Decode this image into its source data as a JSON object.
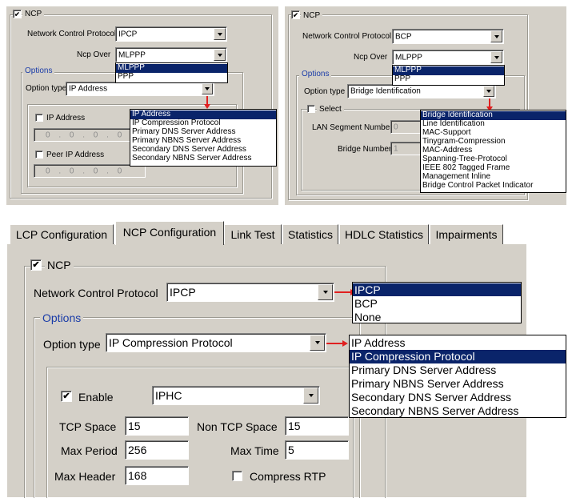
{
  "panel1": {
    "ncp_checkbox_label": "NCP",
    "protocol_label": "Network Control Protocol",
    "protocol_value": "IPCP",
    "ncp_over_label": "Ncp Over",
    "ncp_over_value": "MLPPP",
    "ncp_over_options": [
      "MLPPP",
      "PPP"
    ],
    "options_legend": "Options",
    "option_type_label": "Option type",
    "option_type_value": "IP Address",
    "option_type_options": [
      "IP Address",
      "IP Compression Protocol",
      "Primary DNS Server Address",
      "Primary NBNS Server Address",
      "Secondary DNS Server Address",
      "Secondary NBNS Server Address"
    ],
    "ip_address_label": "IP Address",
    "ip_address_value": "0 . 0 . 0 . 0",
    "peer_ip_label": "Peer IP Address",
    "peer_ip_value": "0 . 0 . 0 . 0"
  },
  "panel2": {
    "ncp_checkbox_label": "NCP",
    "protocol_label": "Network Control Protocol",
    "protocol_value": "BCP",
    "ncp_over_label": "Ncp Over",
    "ncp_over_value": "MLPPP",
    "ncp_over_options": [
      "MLPPP",
      "PPP"
    ],
    "options_legend": "Options",
    "option_type_label": "Option type",
    "option_type_value": "Bridge Identification",
    "option_type_options": [
      "Bridge Identification",
      "Line Identification",
      "MAC-Support",
      "Tinygram-Compression",
      "MAC-Address",
      "Spanning-Tree-Protocol",
      "IEEE 802 Tagged Frame",
      "Management Inline",
      "Bridge Control Packet Indicator"
    ],
    "select_label": "Select",
    "lan_segment_label": "LAN Segment Number",
    "lan_segment_value": "0",
    "bridge_number_label": "Bridge Number",
    "bridge_number_value": "1"
  },
  "panel3": {
    "tabs": [
      "LCP Configuration",
      "NCP Configuration",
      "Link Test",
      "Statistics",
      "HDLC Statistics",
      "Impairments"
    ],
    "ncp_checkbox_label": "NCP",
    "protocol_label": "Network Control Protocol",
    "protocol_value": "IPCP",
    "protocol_options": [
      "IPCP",
      "BCP",
      "None"
    ],
    "options_legend": "Options",
    "option_type_label": "Option type",
    "option_type_value": "IP Compression Protocol",
    "option_type_options": [
      "IP Address",
      "IP Compression Protocol",
      "Primary DNS Server Address",
      "Primary NBNS Server Address",
      "Secondary DNS Server Address",
      "Secondary NBNS Server Address"
    ],
    "enable_label": "Enable",
    "enable_value": "IPHC",
    "tcp_space_label": "TCP Space",
    "tcp_space_value": "15",
    "non_tcp_space_label": "Non TCP Space",
    "non_tcp_space_value": "15",
    "max_period_label": "Max Period",
    "max_period_value": "256",
    "max_time_label": "Max Time",
    "max_time_value": "5",
    "max_header_label": "Max Header",
    "max_header_value": "168",
    "compress_rtp_label": "Compress RTP"
  },
  "colors": {
    "dialog_bg": "#d4d0c8",
    "selection_bg": "#0a246a",
    "legend_blue": "#1a3ca8",
    "arrow_red": "#e02020"
  }
}
